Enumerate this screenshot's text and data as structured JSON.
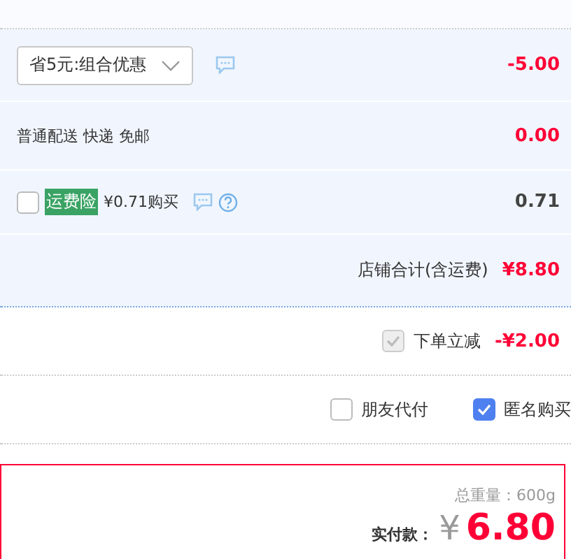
{
  "promo": {
    "select_value": "省5元:组合优惠",
    "amount": "-5.00"
  },
  "delivery": {
    "label": "普通配送 快递 免邮",
    "amount": "0.00"
  },
  "insurance": {
    "checked": false,
    "tag": "运费险",
    "price": "¥0.71购买",
    "amount": "0.71"
  },
  "shop_total": {
    "label": "店铺合计(含运费)",
    "amount": "¥8.80"
  },
  "discount": {
    "checked": true,
    "disabled": true,
    "label": "下单立减",
    "amount": "-¥2.00"
  },
  "options": [
    {
      "label": "朋友代付",
      "checked": false
    },
    {
      "label": "匿名购买",
      "checked": true
    }
  ],
  "summary": {
    "weight": "总重量：600g",
    "pay_label": "实付款：",
    "currency": "¥",
    "pay_amount": "6.80"
  }
}
